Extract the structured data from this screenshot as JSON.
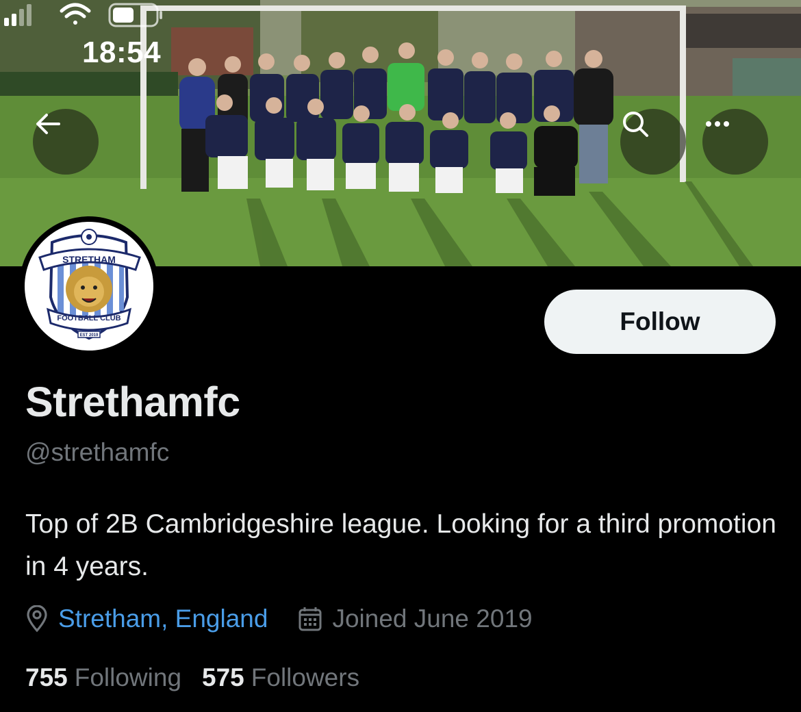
{
  "status_bar": {
    "time": "18:54"
  },
  "banner": {
    "description_icon": "team-photo"
  },
  "nav": {
    "back_icon": "arrow-left-icon",
    "search_icon": "search-icon",
    "more_icon": "more-horizontal-icon"
  },
  "avatar": {
    "badge_top_text": "STRETHAM",
    "badge_bottom_text": "FOOTBALL CLUB",
    "badge_est_text": "EST 2019"
  },
  "profile": {
    "follow_label": "Follow",
    "display_name": "Strethamfc",
    "handle": "@strethamfc",
    "bio": "Top of 2B Cambridgeshire league. Looking for a third promotion in 4 years.",
    "location": "Stretham, England",
    "joined": "Joined June 2019"
  },
  "stats": {
    "following_count": "755",
    "following_label": "Following",
    "followers_count": "575",
    "followers_label": "Followers"
  },
  "colors": {
    "background": "#000000",
    "primary_text": "#e7e9ea",
    "secondary_text": "#71767b",
    "link": "#4a9de8",
    "follow_bg": "#eff3f4"
  }
}
